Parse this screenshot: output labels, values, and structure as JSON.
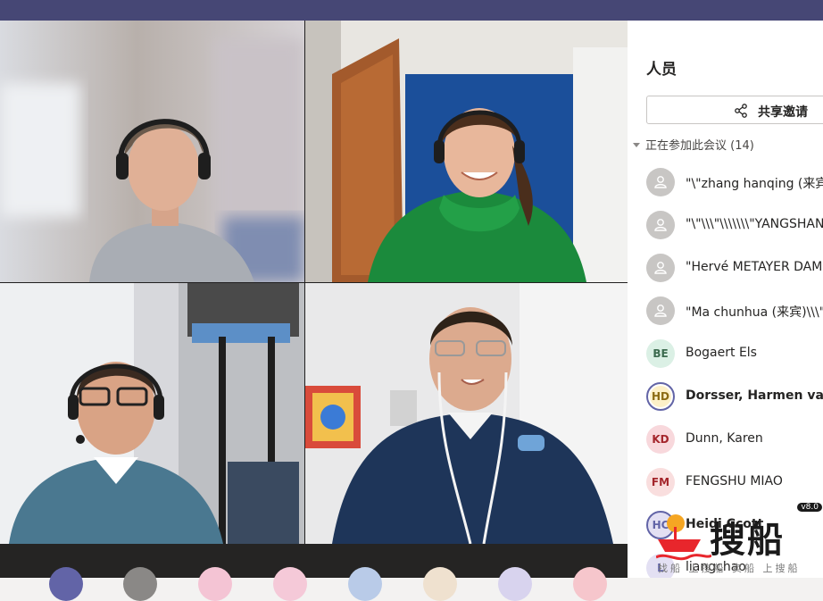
{
  "panel": {
    "title": "人员",
    "share_label": "共享邀请",
    "section": {
      "label": "正在参加此会议 (14)"
    },
    "participants": [
      {
        "initials": "",
        "name": "\"\\\"zhang hanqing (来宾)\\",
        "type": "guest",
        "bold": false
      },
      {
        "initials": "",
        "name": "\"\\\"\\\\\\\"\\\\\\\\\\\\\\\"YANGSHAN",
        "type": "guest",
        "bold": false
      },
      {
        "initials": "",
        "name": "\"Hervé METAYER DAM FR",
        "type": "guest",
        "bold": false
      },
      {
        "initials": "",
        "name": "\"Ma chunhua (来宾)\\\\\\\"\\\"",
        "type": "guest",
        "bold": false
      },
      {
        "initials": "BE",
        "name": "Bogaert Els",
        "type": "BE",
        "bold": false
      },
      {
        "initials": "HD",
        "name": "Dorsser, Harmen van",
        "type": "HD",
        "bold": true
      },
      {
        "initials": "KD",
        "name": "Dunn, Karen",
        "type": "KD",
        "bold": false
      },
      {
        "initials": "FM",
        "name": "FENGSHU MIAO",
        "type": "FM",
        "bold": false
      },
      {
        "initials": "HC",
        "name": "Heidi Ccott",
        "type": "HC",
        "bold": true
      },
      {
        "initials": "L",
        "name": "liangchao",
        "type": "L",
        "bold": false
      }
    ]
  },
  "watermark": {
    "brand": "搜船",
    "sub": "找船 上搜船 卖船 上搜船",
    "version": "v8.0"
  },
  "colors": {
    "teams_bar": "#464775",
    "accent": "#6264a7"
  }
}
